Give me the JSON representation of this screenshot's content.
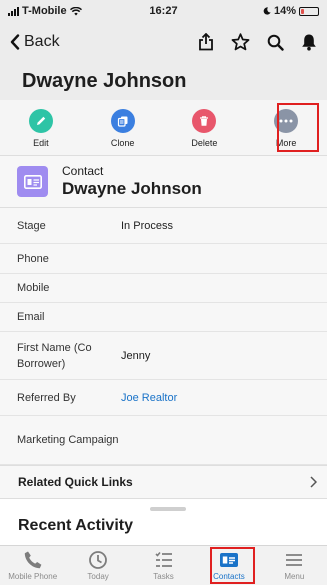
{
  "status_bar": {
    "carrier": "T-Mobile",
    "time": "16:27",
    "battery": "14%",
    "battery_level": 0.14
  },
  "nav": {
    "back_label": "Back"
  },
  "header": {
    "title": "Dwayne Johnson"
  },
  "actions": [
    {
      "label": "Edit",
      "color": "#2ec4a6",
      "icon": "pencil-icon"
    },
    {
      "label": "Clone",
      "color": "#3b7fe0",
      "icon": "clone-icon"
    },
    {
      "label": "Delete",
      "color": "#e8566b",
      "icon": "trash-icon"
    },
    {
      "label": "More",
      "color": "#8a94a6",
      "icon": "more-icon"
    }
  ],
  "record": {
    "type": "Contact",
    "name": "Dwayne Johnson",
    "icon_color": "#9f8cf0"
  },
  "fields": [
    {
      "label": "Stage",
      "value": "In Process"
    },
    {
      "label": "Phone",
      "value": ""
    },
    {
      "label": "Mobile",
      "value": ""
    },
    {
      "label": "Email",
      "value": ""
    },
    {
      "label": "First Name (Co Borrower)",
      "value": "Jenny"
    },
    {
      "label": "Referred By",
      "value": "Joe Realtor"
    },
    {
      "label": "Marketing Campaign",
      "value": ""
    }
  ],
  "related": {
    "title": "Related Quick Links"
  },
  "recent": {
    "title": "Recent Activity"
  },
  "tabs": [
    {
      "label": "Mobile Phone",
      "icon": "phone-icon"
    },
    {
      "label": "Today",
      "icon": "clock-icon"
    },
    {
      "label": "Tasks",
      "icon": "tasks-icon"
    },
    {
      "label": "Contacts",
      "icon": "contact-card-icon",
      "active": true
    },
    {
      "label": "Menu",
      "icon": "menu-icon"
    }
  ],
  "colors": {
    "accent": "#1a73c8",
    "highlight": "#e02020"
  }
}
